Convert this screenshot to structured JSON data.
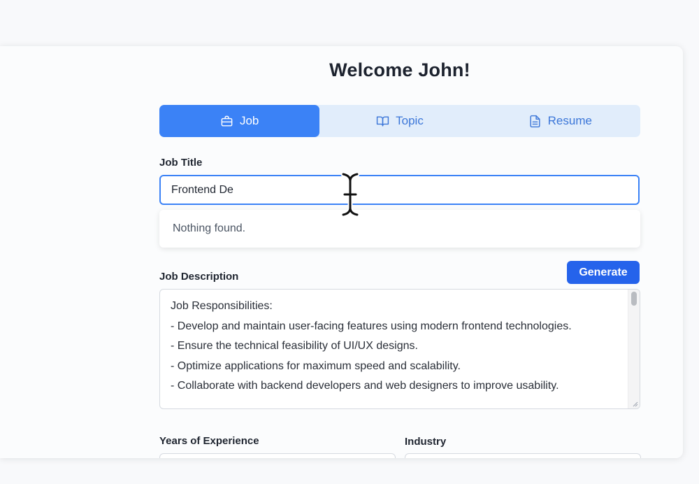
{
  "header": {
    "title": "Welcome John!"
  },
  "tabs": [
    {
      "label": "Job",
      "icon": "briefcase-icon",
      "active": true
    },
    {
      "label": "Topic",
      "icon": "book-open-icon",
      "active": false
    },
    {
      "label": "Resume",
      "icon": "file-text-icon",
      "active": false
    }
  ],
  "job_title": {
    "label": "Job Title",
    "value": "Frontend De",
    "dropdown_message": "Nothing found."
  },
  "job_description": {
    "label": "Job Description",
    "generate_label": "Generate",
    "text": "Job Responsibilities:\n- Develop and maintain user-facing features using modern frontend technologies.\n- Ensure the technical feasibility of UI/UX designs.\n- Optimize applications for maximum speed and scalability.\n- Collaborate with backend developers and web designers to improve usability."
  },
  "years_of_experience": {
    "label": "Years of Experience"
  },
  "industry": {
    "label": "Industry"
  },
  "colors": {
    "accent": "#3b82f6",
    "button": "#2563eb",
    "tab_bar": "#e1edfb"
  }
}
